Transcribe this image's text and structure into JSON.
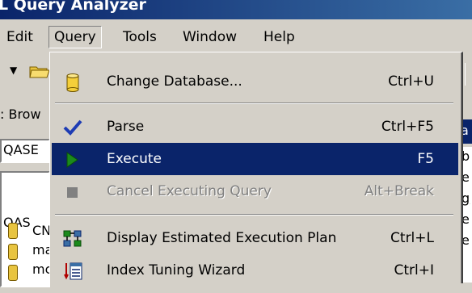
{
  "window": {
    "title": "L Query Analyzer"
  },
  "menubar": {
    "edit": "Edit",
    "query": "Query",
    "tools": "Tools",
    "window": "Window",
    "help": "Help"
  },
  "background": {
    "obj_browser_frag": ": Brow",
    "db_combo_frag": "QASE",
    "tree_root_frag": "QAS",
    "tree_items": [
      "CN",
      "ma",
      "mc"
    ],
    "right_frags": [
      "a",
      "b",
      "e",
      "g",
      "e",
      "e"
    ]
  },
  "menu": {
    "items": [
      {
        "label": "Change Database...",
        "shortcut": "Ctrl+U",
        "icon": "cylinder-database-icon",
        "state": "normal"
      },
      {
        "label": "Parse",
        "shortcut": "Ctrl+F5",
        "icon": "checkmark-icon",
        "state": "normal"
      },
      {
        "label": "Execute",
        "shortcut": "F5",
        "icon": "play-triangle-icon",
        "state": "highlighted"
      },
      {
        "label": "Cancel Executing Query",
        "shortcut": "Alt+Break",
        "icon": "stop-square-icon",
        "state": "disabled"
      },
      {
        "label": "Display Estimated Execution Plan",
        "shortcut": "Ctrl+L",
        "icon": "execution-plan-icon",
        "state": "normal"
      },
      {
        "label": "Index Tuning Wizard",
        "shortcut": "Ctrl+I",
        "icon": "index-wizard-icon",
        "state": "normal"
      }
    ]
  },
  "colors": {
    "highlight": "#0a246a",
    "face": "#d4d0c8",
    "check": "#1e3cb4",
    "play": "#1b8a1b"
  }
}
